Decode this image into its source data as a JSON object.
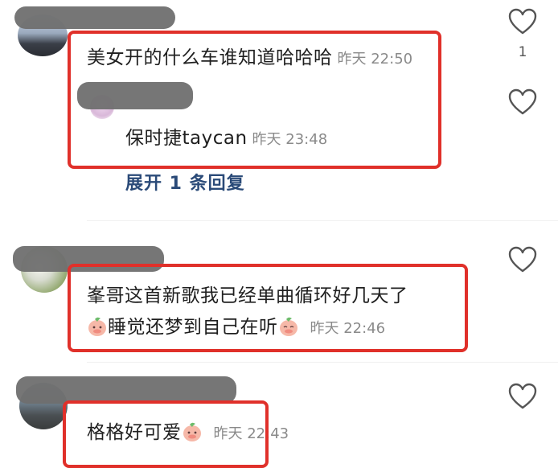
{
  "comments": [
    {
      "text": "美女开的什么车谁知道哈哈哈",
      "time": "昨天 22:50",
      "likes": "1",
      "reply": {
        "text": "保时捷taycan",
        "time": "昨天 23:48"
      },
      "expand_label": "展开 1 条回复"
    },
    {
      "text_line1": "峯哥这首新歌我已经单曲循环好几天了",
      "text_line2": "睡觉还梦到自己在听",
      "time": "昨天 22:46"
    },
    {
      "text": "格格好可爱",
      "time": "昨天 22:43"
    }
  ],
  "icons": {
    "like": "heart-outline-icon",
    "emoji": "peach-emoji-icon"
  },
  "colors": {
    "highlight": "#e0302a",
    "link": "#2a4a78",
    "timestamp": "#8a8a8a"
  }
}
